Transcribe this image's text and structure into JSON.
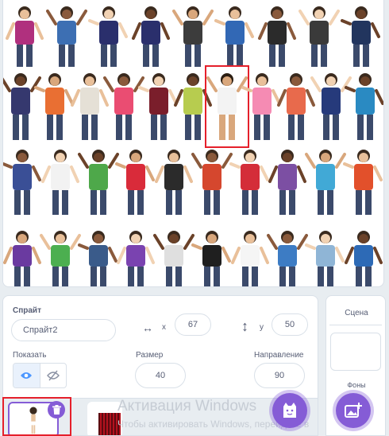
{
  "library": {
    "figure_colors": [
      [
        "#b0307e",
        "#3d6fb3",
        "#2a2f6c",
        "#2a2f6c",
        "#3c3c3c",
        "#3268b5",
        "#2b2b2b",
        "#3a3a3a",
        "#22355e"
      ],
      [
        "#35386e",
        "#e96f33",
        "#e5e0d6",
        "#ea4d72",
        "#7a1e2b",
        "#b7cc4f",
        "#ffffff",
        "#f58bb3",
        "#e86a4c",
        "#263a7b",
        "#2a8ac2"
      ],
      [
        "#3a4f96",
        "#f2f2f2",
        "#4ea84a",
        "#d92b3a",
        "#2b2b2b",
        "#d5472e",
        "#d42d39",
        "#7c4fa3",
        "#41a9d6",
        "#e2502b"
      ],
      [
        "#6a3aa0",
        "#4caf50",
        "#3a5b8a",
        "#7a43b0",
        "#dfdfdf",
        "#1f1f1f",
        "#f5f5f5",
        "#3d7cc4",
        "#8fb5d6",
        "#2d6ab6"
      ]
    ],
    "selected_costume": "Avery"
  },
  "sprite": {
    "label": "Спрайт",
    "name": "Спрайт2",
    "x_label": "x",
    "x": "67",
    "y_label": "y",
    "y": "50",
    "show_label": "Показать",
    "size_label": "Размер",
    "size": "40",
    "direction_label": "Направление",
    "direction": "90"
  },
  "icons": {
    "x_arrows": "↔",
    "y_arrows": "↕",
    "eye": "eye-icon",
    "eye_off": "eye-off-icon",
    "trash": "trash-icon",
    "add_sprite": "cat-add-icon",
    "add_backdrop": "image-add-icon"
  },
  "stage": {
    "label": "Сцена",
    "backdrops_label": "Фоны"
  },
  "watermark": {
    "title": "Активация Windows",
    "subtitle": "Чтобы активировать Windows, перейдите в"
  },
  "colors": {
    "accent": "#855cd6",
    "highlight": "#e5202b",
    "toggle_active_icon": "#4c97ff"
  }
}
